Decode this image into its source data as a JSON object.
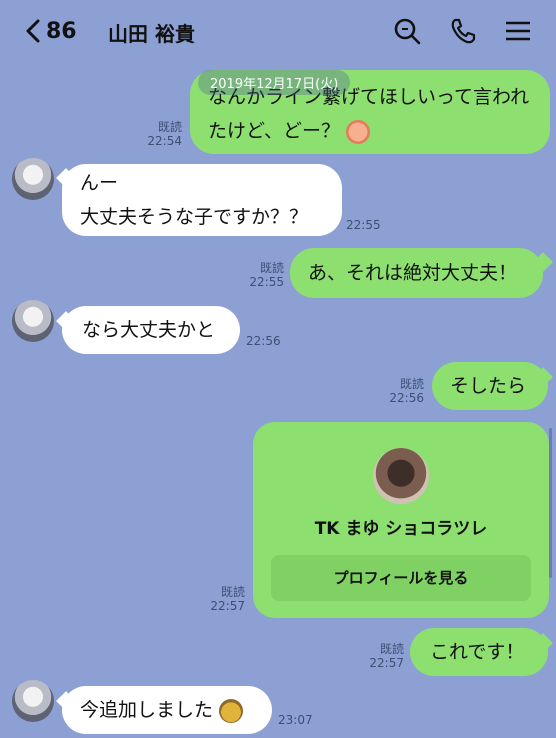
{
  "header": {
    "back_count": "86",
    "title": "山田 裕貴"
  },
  "icons": {
    "back": "chevron-left-icon",
    "search": "search-icon",
    "call": "phone-icon",
    "menu": "menu-icon"
  },
  "date_label": "2019年12月17日(火)",
  "messages": [
    {
      "dir": "out",
      "text": "なんかライン繋げてほしいって言われたけど、どー？",
      "read": "既読",
      "time": "22:54",
      "emoji": "face-emoji"
    },
    {
      "dir": "in",
      "line1": "んー",
      "line2": "大丈夫そうな子ですか？？",
      "time": "22:55"
    },
    {
      "dir": "out",
      "text": "あ、それは絶対大丈夫！",
      "read": "既読",
      "time": "22:55"
    },
    {
      "dir": "in",
      "text": "なら大丈夫かと",
      "time": "22:56"
    },
    {
      "dir": "out",
      "text": "そしたら",
      "read": "既読",
      "time": "22:56"
    },
    {
      "dir": "out",
      "text": "これです！",
      "read": "既読",
      "time": "22:57"
    },
    {
      "dir": "in",
      "text": "今追加しました",
      "time": "23:07",
      "emoji": "bowing-emoji"
    }
  ],
  "contact_card": {
    "name": "TK まゆ ショコラツレ",
    "button": "プロフィールを見る",
    "read": "既読",
    "time": "22:57"
  },
  "colors": {
    "background": "#8da0d4",
    "outgoing": "#8de06f",
    "incoming": "#ffffff"
  }
}
